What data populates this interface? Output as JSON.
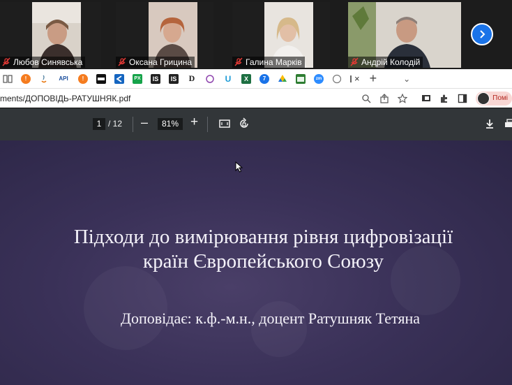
{
  "meeting": {
    "participants": [
      {
        "name": "Любов Синявська",
        "muted": true
      },
      {
        "name": "Оксана Грицина",
        "muted": true
      },
      {
        "name": "Галина Марків",
        "muted": true
      },
      {
        "name": "Андрій Колодій",
        "muted": true
      }
    ],
    "next_icon": "chevron-right-icon"
  },
  "browser": {
    "new_tab_symbol": "+",
    "tab_dropdown_symbol": "⌄",
    "tab_close_symbol": "×",
    "url": "ments/ДОПОВІДЬ-РАТУШНЯК.pdf",
    "profile_label": "Помі"
  },
  "pdf_viewer": {
    "current_page": "1",
    "total_pages": "/ 12",
    "zoom_out_symbol": "–",
    "zoom": "81%",
    "zoom_in_symbol": "+"
  },
  "slide": {
    "title_line1": "Підходи до вимірювання рівня цифровізації",
    "title_line2": "країн Європейського Союзу",
    "subtitle": "Доповідає: к.ф.-м.н., доцент Ратушняк Тетяна"
  },
  "colors": {
    "accent_blue": "#1a73e8",
    "toolbar_bg": "#323639",
    "slide_bg": "#3a3158",
    "muted_red": "#e53935"
  }
}
